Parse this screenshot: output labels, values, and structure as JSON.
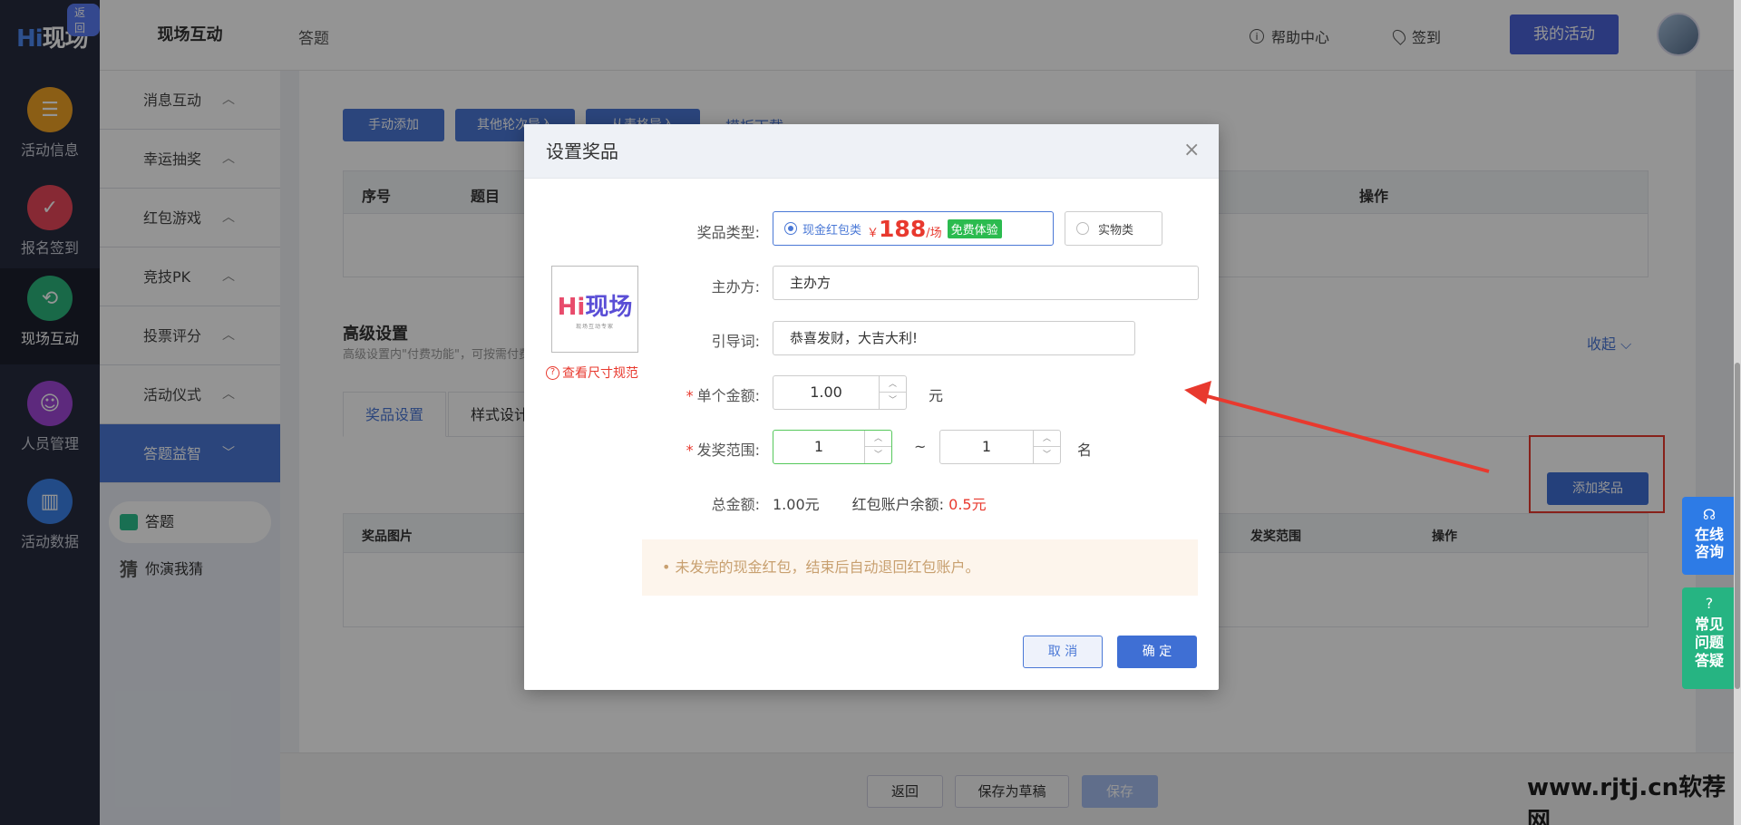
{
  "brand": {
    "logo_h": "Hi",
    "logo_rest": "现场",
    "back_badge": "返回"
  },
  "rail": [
    {
      "label": "活动信息",
      "icon": "document-icon",
      "color": "#f0a225"
    },
    {
      "label": "报名签到",
      "icon": "calendar-check-icon",
      "color": "#e8485a"
    },
    {
      "label": "现场互动",
      "icon": "interact-icon",
      "color": "#2bb57c"
    },
    {
      "label": "人员管理",
      "icon": "user-card-icon",
      "color": "#a047d8"
    },
    {
      "label": "活动数据",
      "icon": "bar-chart-icon",
      "color": "#3b82e8"
    }
  ],
  "side2": {
    "title": "现场互动",
    "groups": [
      "消息互动",
      "幸运抽奖",
      "红包游戏",
      "竞技PK",
      "投票评分",
      "活动仪式",
      "答题益智"
    ],
    "subs": [
      "答题",
      "你演我猜"
    ],
    "sub2_icon_text": "猜"
  },
  "topbar": {
    "crumb": "答题",
    "help": "帮助中心",
    "help_glyph": "i",
    "signin": "签到",
    "my_activity": "我的活动"
  },
  "main": {
    "buttons": [
      "手动添加",
      "其他轮次导入",
      "从表格导入"
    ],
    "template_link": "模板下载",
    "table_headers": [
      "序号",
      "题目",
      "操作"
    ],
    "adv_title": "高级设置",
    "adv_desc": "高级设置内\"付费功能\"，可按需付费",
    "collapse": "收起 ⌵",
    "tabs": [
      "奖品设置",
      "样式设计"
    ],
    "add_prize": "添加奖品",
    "prize_table_headers": [
      "奖品图片",
      "发奖范围",
      "操作"
    ]
  },
  "bottom": {
    "back": "返回",
    "draft": "保存为草稿",
    "save": "保存"
  },
  "modal": {
    "title": "设置奖品",
    "close": "×",
    "logo_text_h": "Hi",
    "logo_text_rest": "现场",
    "logo_sub": "现场互动专家",
    "size_link": "查看尺寸规范",
    "size_link_glyph": "?",
    "labels": {
      "type": "奖品类型:",
      "organizer": "主办方:",
      "guide": "引导词:",
      "amount": "单个金额:",
      "range": "发奖范围:",
      "total": "总金额:"
    },
    "required_mark": "*",
    "type_cash": "现金红包类",
    "price_symbol": "￥",
    "price_value": "188",
    "price_unit": "/场",
    "free_tag": "免费体验",
    "type_physical": "实物类",
    "organizer_value": "主办方",
    "guide_value": "恭喜发财，大吉大利!",
    "amount_value": "1.00",
    "amount_unit": "元",
    "range_from": "1",
    "range_sep": "~",
    "range_to": "1",
    "range_unit": "名",
    "stepper_up": "︿",
    "stepper_down": "﹀",
    "total_value": "1.00元",
    "balance_label": "红包账户余额:",
    "balance_value": "0.5元",
    "notice": "• 未发完的现金红包，结束后自动退回红包账户。",
    "cancel": "取 消",
    "ok": "确 定"
  },
  "floats": {
    "online": [
      "在线",
      "咨询"
    ],
    "online_icon": "☊",
    "faq": [
      "常见",
      "问题",
      "答疑"
    ],
    "faq_icon": "?"
  },
  "watermark": "www.rjtj.cn软荐网"
}
